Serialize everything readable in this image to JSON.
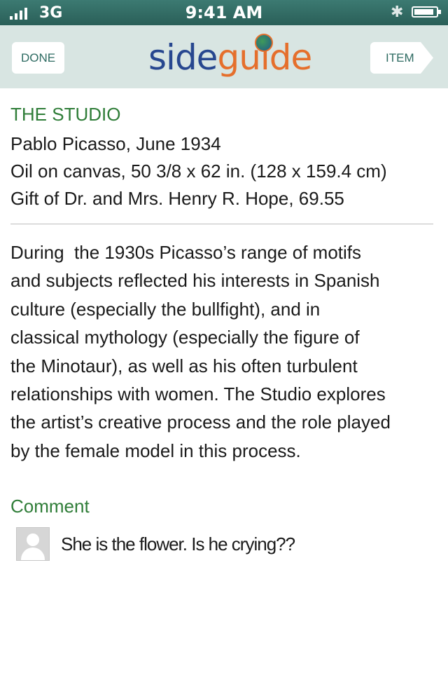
{
  "status_bar": {
    "carrier": "3G",
    "time": "9:41 AM",
    "signal_bars": 4,
    "battery_level": 0.9
  },
  "nav": {
    "done_label": "DONE",
    "item_label": "ITEM",
    "logo_side": "side",
    "logo_guide": "guide"
  },
  "artwork": {
    "title": "THE STUDIO",
    "artist_date": "Pablo Picasso, June 1934",
    "medium": "Oil on canvas, 50 3/8 x 62 in. (128 x 159.4 cm)",
    "credit": "Gift of Dr. and Mrs. Henry R. Hope, 69.55",
    "description": "During  the 1930s Picasso’s range of motifs\nand subjects reflected his interests in Spanish\nculture (especially the bullfight), and in\nclassical mythology (especially the figure of\nthe Minotaur), as well as his often turbulent\nrelationships with women. The Studio explores\nthe artist’s creative process and the role played\nby the female model in this process."
  },
  "comments": {
    "heading": "Comment",
    "items": [
      {
        "text": "She is the flower. Is he crying??"
      }
    ]
  },
  "colors": {
    "heading_green": "#2f7d38",
    "nav_background": "#d8e5e2",
    "status_bar": "#2a5f58",
    "logo_blue": "#27478f",
    "logo_orange": "#e56f2c"
  }
}
